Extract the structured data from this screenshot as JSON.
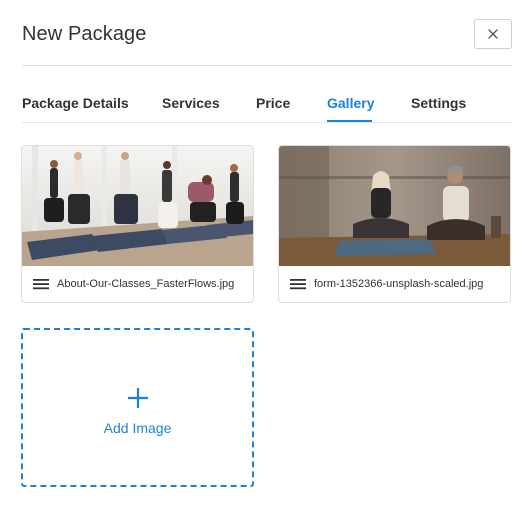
{
  "modal": {
    "title": "New Package",
    "close_icon": "close-icon"
  },
  "tabs": [
    {
      "label": "Package Details",
      "active": false
    },
    {
      "label": "Services",
      "active": false
    },
    {
      "label": "Price",
      "active": false
    },
    {
      "label": "Gallery",
      "active": true
    },
    {
      "label": "Settings",
      "active": false
    }
  ],
  "gallery": {
    "images": [
      {
        "filename": "About-Our-Classes_FasterFlows.jpg",
        "drag_icon": "drag-handle-icon"
      },
      {
        "filename": "form-1352366-unsplash-scaled.jpg",
        "drag_icon": "drag-handle-icon"
      }
    ],
    "add_label": "Add Image",
    "add_icon": "plus-icon"
  },
  "colors": {
    "accent": "#1e82d2",
    "text": "#333333",
    "border": "#dcdcdc"
  }
}
